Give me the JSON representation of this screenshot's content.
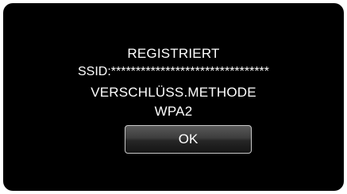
{
  "dialog": {
    "title": "REGISTRIERT",
    "ssid_line": "SSID:********************************",
    "encryption_label": "VERSCHLÜSS.METHODE",
    "encryption_value": "WPA2",
    "ok_label": "OK"
  }
}
